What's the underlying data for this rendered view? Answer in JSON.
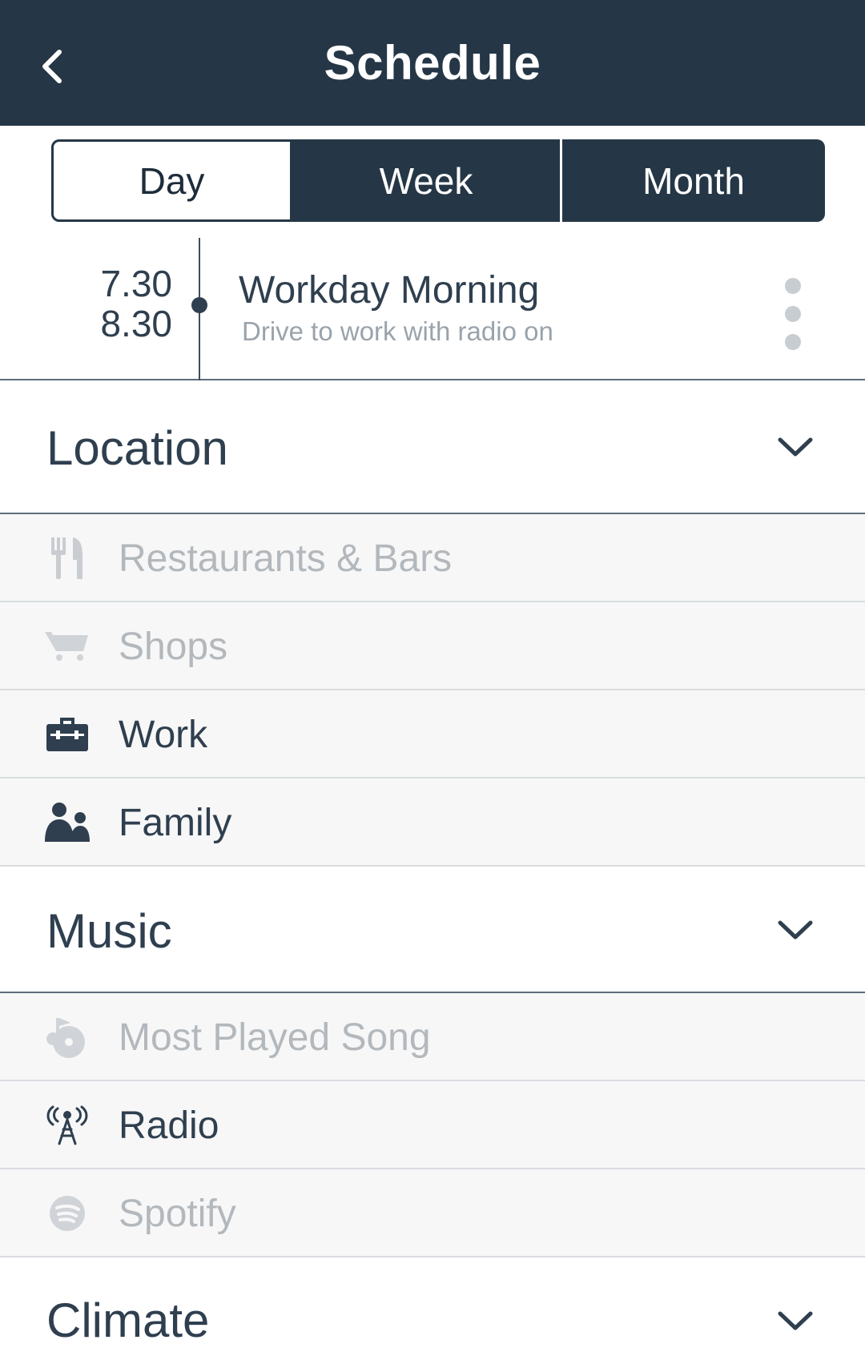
{
  "header": {
    "title": "Schedule",
    "back_icon": "chevron-left-icon"
  },
  "tabs": [
    {
      "label": "Day",
      "active": true
    },
    {
      "label": "Week",
      "active": false
    },
    {
      "label": "Month",
      "active": false
    }
  ],
  "event": {
    "start": "7.30",
    "end": "8.30",
    "title": "Workday Morning",
    "description": "Drive to work with radio on",
    "menu_icon": "more-vertical-icon"
  },
  "sections": {
    "location": {
      "label": "Location",
      "items": [
        {
          "label": "Restaurants & Bars",
          "icon": "fork-knife-icon",
          "enabled": false
        },
        {
          "label": "Shops",
          "icon": "shopping-cart-icon",
          "enabled": false
        },
        {
          "label": "Work",
          "icon": "briefcase-icon",
          "enabled": true
        },
        {
          "label": "Family",
          "icon": "family-icon",
          "enabled": true
        }
      ]
    },
    "music": {
      "label": "Music",
      "items": [
        {
          "label": "Most Played Song",
          "icon": "music-disc-icon",
          "enabled": false
        },
        {
          "label": "Radio",
          "icon": "radio-tower-icon",
          "enabled": true
        },
        {
          "label": "Spotify",
          "icon": "spotify-icon",
          "enabled": false
        }
      ]
    },
    "climate": {
      "label": "Climate"
    }
  },
  "colors": {
    "header_bg": "#253746",
    "text_dark": "#2f3f4f",
    "text_disabled": "#b3b8bd",
    "item_bg": "#f7f7f7"
  }
}
